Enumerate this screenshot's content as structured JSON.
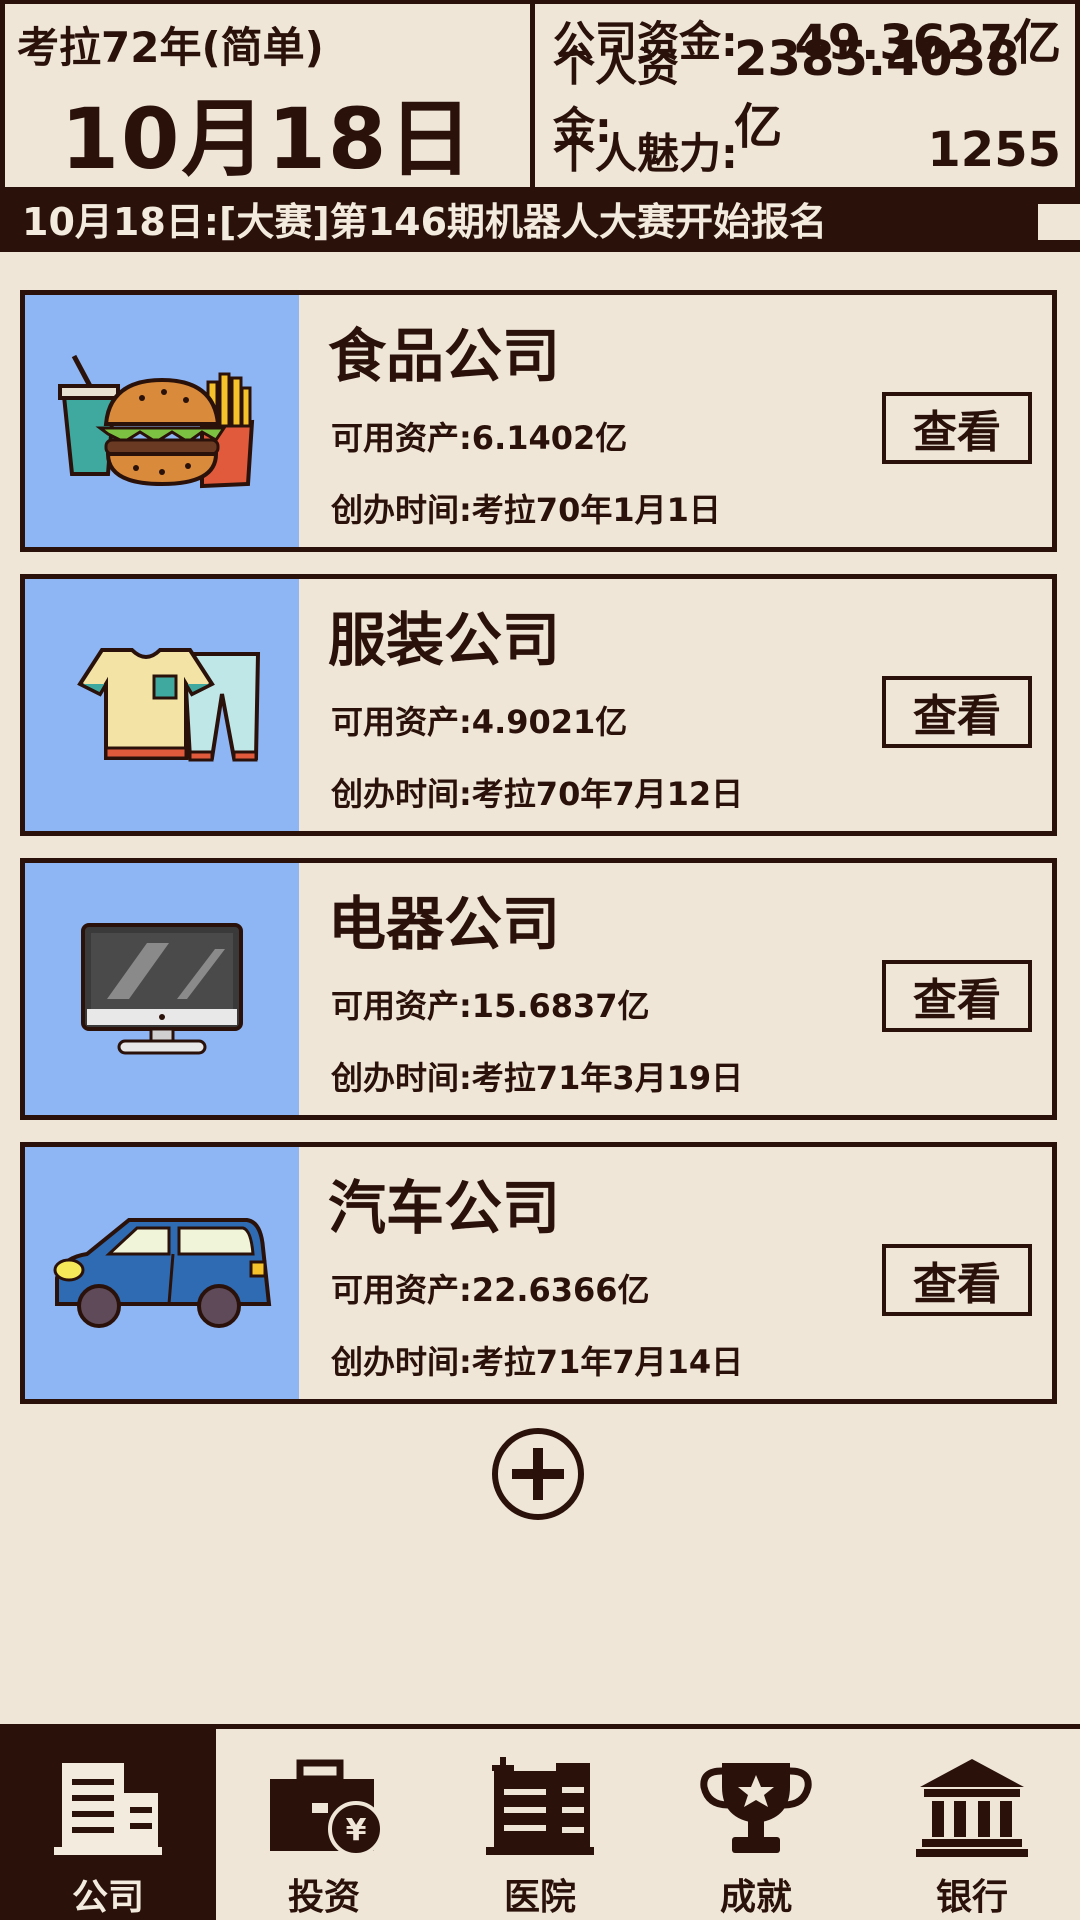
{
  "header": {
    "year_label": "考拉72年(简单)",
    "date": "10月18日",
    "stats": [
      {
        "label": "公司资金:",
        "value": "49.3627亿"
      },
      {
        "label": "个人资金:",
        "value": "2385.4038亿"
      },
      {
        "label": "个人魅力:",
        "value": "1255"
      }
    ]
  },
  "ticker": {
    "text": "10月18日:[大赛]第146期机器人大赛开始报名"
  },
  "companies": [
    {
      "name": "食品公司",
      "asset": "可用资产:6.1402亿",
      "founded": "创办时间:考拉70年1月1日",
      "view_label": "查看",
      "icon": "burger-icon"
    },
    {
      "name": "服装公司",
      "asset": "可用资产:4.9021亿",
      "founded": "创办时间:考拉70年7月12日",
      "view_label": "查看",
      "icon": "clothes-icon"
    },
    {
      "name": "电器公司",
      "asset": "可用资产:15.6837亿",
      "founded": "创办时间:考拉71年3月19日",
      "view_label": "查看",
      "icon": "monitor-icon"
    },
    {
      "name": "汽车公司",
      "asset": "可用资产:22.6366亿",
      "founded": "创办时间:考拉71年7月14日",
      "view_label": "查看",
      "icon": "car-icon"
    }
  ],
  "nav": [
    {
      "label": "公司",
      "icon": "building-icon",
      "active": true
    },
    {
      "label": "投资",
      "icon": "briefcase-icon",
      "active": false
    },
    {
      "label": "医院",
      "icon": "hospital-icon",
      "active": false
    },
    {
      "label": "成就",
      "icon": "trophy-icon",
      "active": false
    },
    {
      "label": "银行",
      "icon": "bank-icon",
      "active": false
    }
  ],
  "colors": {
    "background": "#efe6d8",
    "dark": "#2a120b",
    "card_image_bg": "#8fb6f4"
  }
}
